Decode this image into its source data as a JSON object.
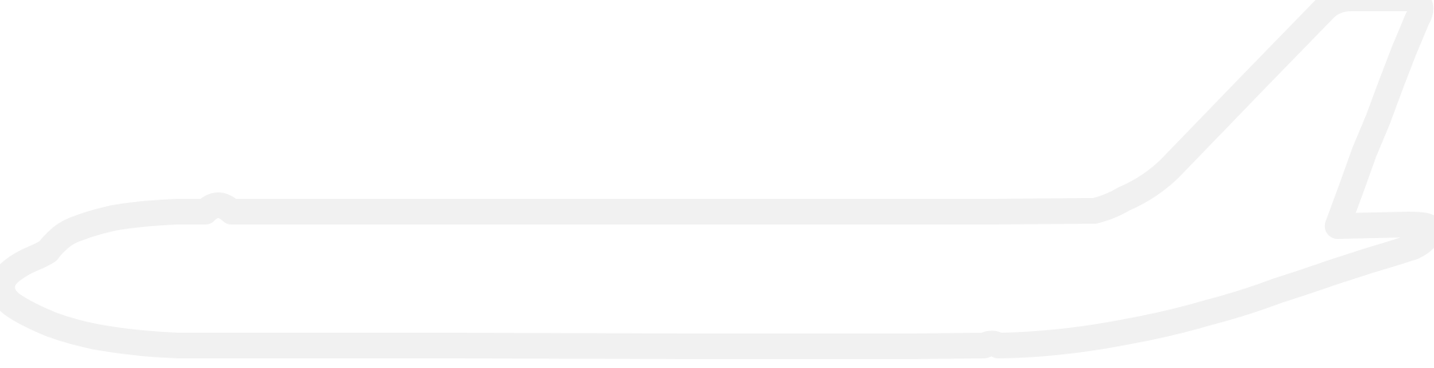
{
  "figure": {
    "subject": "airplane-fuselage-outline",
    "colors": {
      "background": "#ffffff",
      "outline": "#f1f1f1"
    }
  }
}
